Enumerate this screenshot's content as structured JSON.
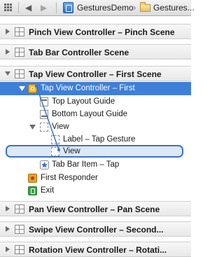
{
  "jumpbar": {
    "project": "GesturesDemo",
    "folder": "Gestures..."
  },
  "outline": {
    "scenes": [
      {
        "label": "Pinch View Controller – Pinch Scene",
        "expanded": false
      },
      {
        "label": "Tab Bar Controller Scene",
        "expanded": false
      },
      {
        "label": "Tap View Controller – First Scene",
        "expanded": true
      },
      {
        "label": "Pan View Controller – Pan Scene",
        "expanded": false
      },
      {
        "label": "Swipe View Controller – Second...",
        "expanded": false
      },
      {
        "label": "Rotation View Controller – Rotati...",
        "expanded": false
      }
    ],
    "tap_scene_items": {
      "controller": "Tap View Controller – First",
      "top_guide": "Top Layout Guide",
      "bottom_guide": "Bottom Layout Guide",
      "view": "View",
      "label_gesture": "Label – Tap Gesture",
      "subview": "View",
      "tab_item": "Tab Bar Item – Tap",
      "first_responder": "First Responder",
      "exit": "Exit"
    }
  },
  "colors": {
    "selection": "#3f7fd8",
    "drag_target": "#3a73c9"
  }
}
